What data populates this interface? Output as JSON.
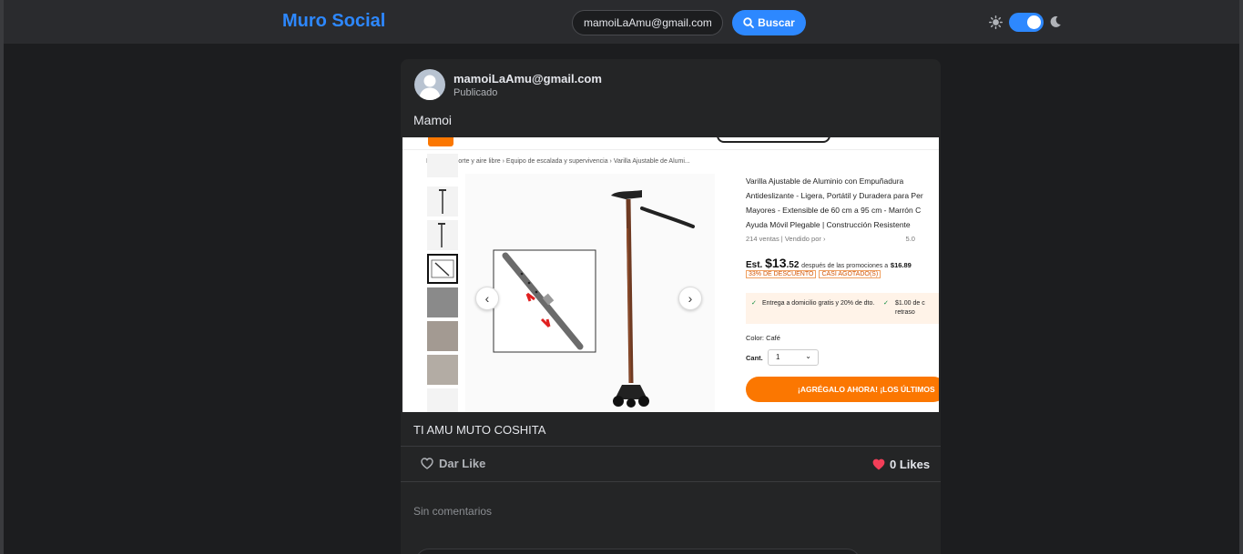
{
  "app": {
    "title": "Muro Social"
  },
  "header": {
    "search_value": "mamoiLaAmu@gmail.com",
    "search_button_label": "Buscar"
  },
  "post": {
    "author": "mamoiLaAmu@gmail.com",
    "status": "Publicado",
    "title": "Mamoi",
    "caption": "TI AMU MUTO COSHITA",
    "like_label": "Dar Like",
    "likes_text": "0 Likes",
    "comments_empty": "Sin comentarios"
  },
  "product_image": {
    "breadcrumb": "Inicio  ›  Deporte y aire libre  ›  Equipo de escalada y supervivencia  ›  Varilla Ajustable de Alumi...",
    "title": "Varilla Ajustable de Aluminio con Empuñadura Antideslizante - Ligera, Portátil y Duradera para Per Mayores - Extensible de 60 cm a 95 cm - Marrón C Ayuda Móvil Plegable | Construcción Resistente",
    "sales": "214 ventas",
    "sold_by": "Vendido por",
    "rating": "5.0",
    "price_prefix": "Est.",
    "price_dollars": "$13",
    "price_cents": ".52",
    "promo_text": "después de las promociones a",
    "promo_price": "$16.89",
    "discount_badge": "33% DE DESCUENTO",
    "stock_badge": "CASI AGOTADO(S)",
    "shipping_1": "Entrega a domicilio gratis y 20% de dto.",
    "shipping_2": "$1.00 de c retraso",
    "color_label": "Color: Café",
    "qty_label": "Cant.",
    "qty_value": "1",
    "cta": "¡AGRÉGALO AHORA! ¡LOS ÚLTIMOS"
  },
  "colors": {
    "accent": "#2d88ff",
    "background": "#1c1d1f",
    "card": "#242526",
    "heart": "#f33e58",
    "cta_orange": "#fb7701"
  },
  "icons": {
    "search": "search-icon",
    "theme_light": "sun-icon",
    "theme_dark": "moon-icon",
    "like": "heart-outline-icon",
    "likes_count": "heart-filled-icon"
  }
}
